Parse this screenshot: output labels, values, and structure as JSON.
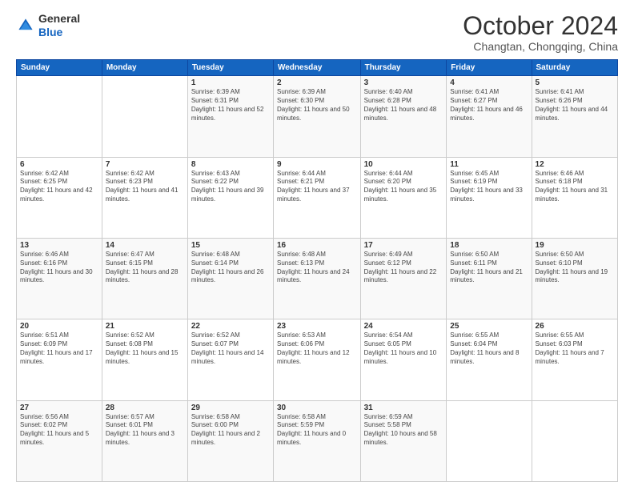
{
  "logo": {
    "general": "General",
    "blue": "Blue"
  },
  "header": {
    "month": "October 2024",
    "location": "Changtan, Chongqing, China"
  },
  "weekdays": [
    "Sunday",
    "Monday",
    "Tuesday",
    "Wednesday",
    "Thursday",
    "Friday",
    "Saturday"
  ],
  "weeks": [
    [
      {
        "day": "",
        "info": ""
      },
      {
        "day": "",
        "info": ""
      },
      {
        "day": "1",
        "info": "Sunrise: 6:39 AM\nSunset: 6:31 PM\nDaylight: 11 hours and 52 minutes."
      },
      {
        "day": "2",
        "info": "Sunrise: 6:39 AM\nSunset: 6:30 PM\nDaylight: 11 hours and 50 minutes."
      },
      {
        "day": "3",
        "info": "Sunrise: 6:40 AM\nSunset: 6:28 PM\nDaylight: 11 hours and 48 minutes."
      },
      {
        "day": "4",
        "info": "Sunrise: 6:41 AM\nSunset: 6:27 PM\nDaylight: 11 hours and 46 minutes."
      },
      {
        "day": "5",
        "info": "Sunrise: 6:41 AM\nSunset: 6:26 PM\nDaylight: 11 hours and 44 minutes."
      }
    ],
    [
      {
        "day": "6",
        "info": "Sunrise: 6:42 AM\nSunset: 6:25 PM\nDaylight: 11 hours and 42 minutes."
      },
      {
        "day": "7",
        "info": "Sunrise: 6:42 AM\nSunset: 6:23 PM\nDaylight: 11 hours and 41 minutes."
      },
      {
        "day": "8",
        "info": "Sunrise: 6:43 AM\nSunset: 6:22 PM\nDaylight: 11 hours and 39 minutes."
      },
      {
        "day": "9",
        "info": "Sunrise: 6:44 AM\nSunset: 6:21 PM\nDaylight: 11 hours and 37 minutes."
      },
      {
        "day": "10",
        "info": "Sunrise: 6:44 AM\nSunset: 6:20 PM\nDaylight: 11 hours and 35 minutes."
      },
      {
        "day": "11",
        "info": "Sunrise: 6:45 AM\nSunset: 6:19 PM\nDaylight: 11 hours and 33 minutes."
      },
      {
        "day": "12",
        "info": "Sunrise: 6:46 AM\nSunset: 6:18 PM\nDaylight: 11 hours and 31 minutes."
      }
    ],
    [
      {
        "day": "13",
        "info": "Sunrise: 6:46 AM\nSunset: 6:16 PM\nDaylight: 11 hours and 30 minutes."
      },
      {
        "day": "14",
        "info": "Sunrise: 6:47 AM\nSunset: 6:15 PM\nDaylight: 11 hours and 28 minutes."
      },
      {
        "day": "15",
        "info": "Sunrise: 6:48 AM\nSunset: 6:14 PM\nDaylight: 11 hours and 26 minutes."
      },
      {
        "day": "16",
        "info": "Sunrise: 6:48 AM\nSunset: 6:13 PM\nDaylight: 11 hours and 24 minutes."
      },
      {
        "day": "17",
        "info": "Sunrise: 6:49 AM\nSunset: 6:12 PM\nDaylight: 11 hours and 22 minutes."
      },
      {
        "day": "18",
        "info": "Sunrise: 6:50 AM\nSunset: 6:11 PM\nDaylight: 11 hours and 21 minutes."
      },
      {
        "day": "19",
        "info": "Sunrise: 6:50 AM\nSunset: 6:10 PM\nDaylight: 11 hours and 19 minutes."
      }
    ],
    [
      {
        "day": "20",
        "info": "Sunrise: 6:51 AM\nSunset: 6:09 PM\nDaylight: 11 hours and 17 minutes."
      },
      {
        "day": "21",
        "info": "Sunrise: 6:52 AM\nSunset: 6:08 PM\nDaylight: 11 hours and 15 minutes."
      },
      {
        "day": "22",
        "info": "Sunrise: 6:52 AM\nSunset: 6:07 PM\nDaylight: 11 hours and 14 minutes."
      },
      {
        "day": "23",
        "info": "Sunrise: 6:53 AM\nSunset: 6:06 PM\nDaylight: 11 hours and 12 minutes."
      },
      {
        "day": "24",
        "info": "Sunrise: 6:54 AM\nSunset: 6:05 PM\nDaylight: 11 hours and 10 minutes."
      },
      {
        "day": "25",
        "info": "Sunrise: 6:55 AM\nSunset: 6:04 PM\nDaylight: 11 hours and 8 minutes."
      },
      {
        "day": "26",
        "info": "Sunrise: 6:55 AM\nSunset: 6:03 PM\nDaylight: 11 hours and 7 minutes."
      }
    ],
    [
      {
        "day": "27",
        "info": "Sunrise: 6:56 AM\nSunset: 6:02 PM\nDaylight: 11 hours and 5 minutes."
      },
      {
        "day": "28",
        "info": "Sunrise: 6:57 AM\nSunset: 6:01 PM\nDaylight: 11 hours and 3 minutes."
      },
      {
        "day": "29",
        "info": "Sunrise: 6:58 AM\nSunset: 6:00 PM\nDaylight: 11 hours and 2 minutes."
      },
      {
        "day": "30",
        "info": "Sunrise: 6:58 AM\nSunset: 5:59 PM\nDaylight: 11 hours and 0 minutes."
      },
      {
        "day": "31",
        "info": "Sunrise: 6:59 AM\nSunset: 5:58 PM\nDaylight: 10 hours and 58 minutes."
      },
      {
        "day": "",
        "info": ""
      },
      {
        "day": "",
        "info": ""
      }
    ]
  ]
}
